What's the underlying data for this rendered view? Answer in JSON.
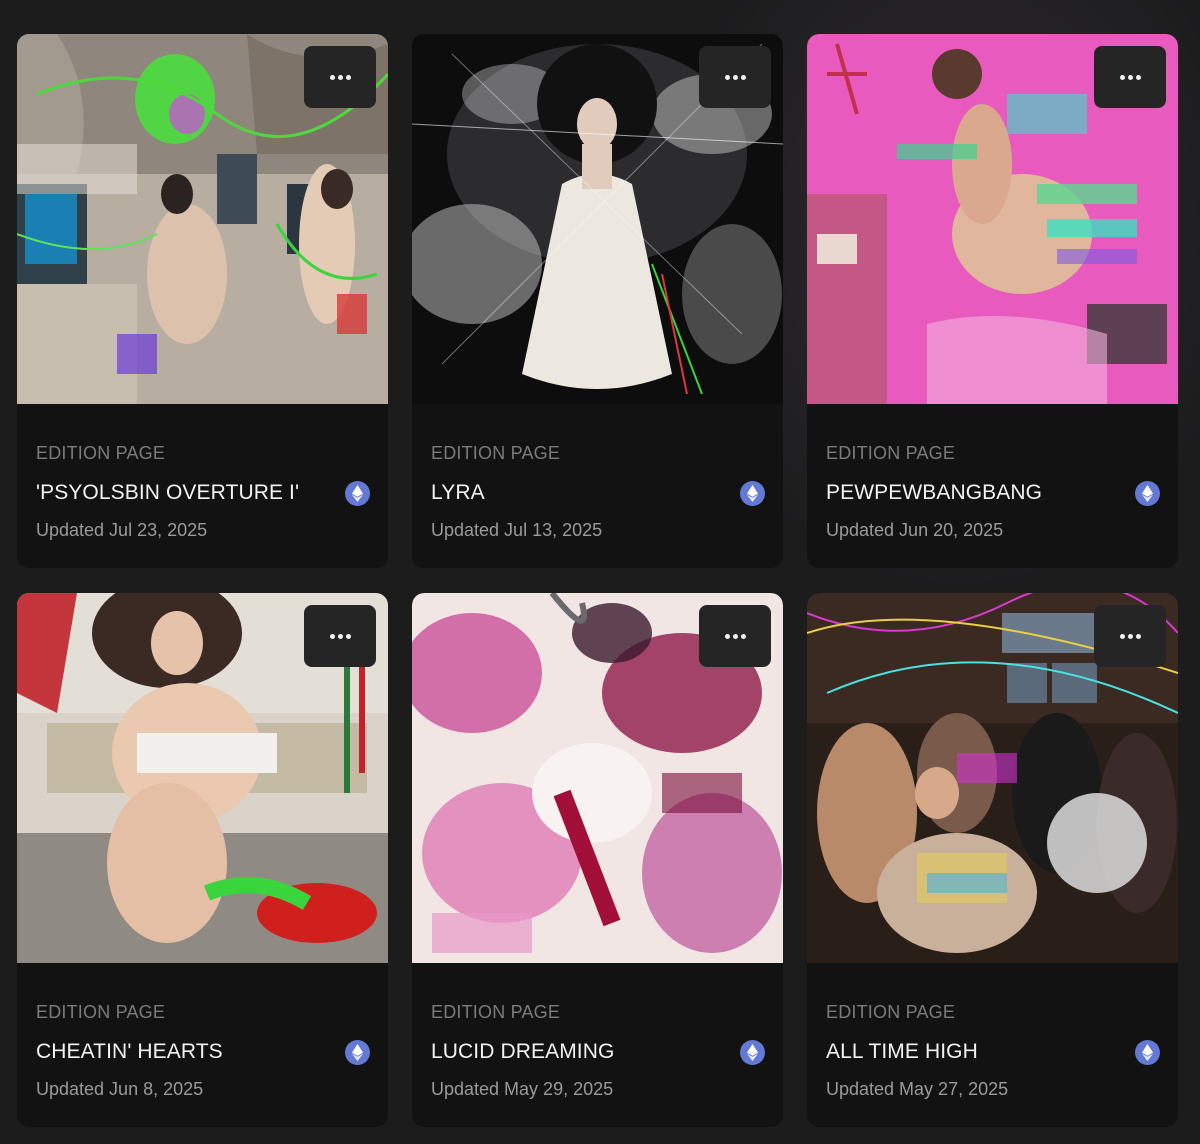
{
  "cards": [
    {
      "kind": "EDITION PAGE",
      "title": "'PSYOLSBIN OVERTURE I'",
      "updated": "Updated Jul 23, 2025",
      "chain_icon": "ethereum-icon",
      "menu_icon": "more-horizontal-icon"
    },
    {
      "kind": "EDITION PAGE",
      "title": "LYRA",
      "updated": "Updated Jul 13, 2025",
      "chain_icon": "ethereum-icon",
      "menu_icon": "more-horizontal-icon"
    },
    {
      "kind": "EDITION PAGE",
      "title": "PEWPEWBANGBANG",
      "updated": "Updated Jun 20, 2025",
      "chain_icon": "ethereum-icon",
      "menu_icon": "more-horizontal-icon"
    },
    {
      "kind": "EDITION PAGE",
      "title": "CHEATIN' HEARTS",
      "updated": "Updated Jun 8, 2025",
      "chain_icon": "ethereum-icon",
      "menu_icon": "more-horizontal-icon"
    },
    {
      "kind": "EDITION PAGE",
      "title": "LUCID DREAMING",
      "updated": "Updated May 29, 2025",
      "chain_icon": "ethereum-icon",
      "menu_icon": "more-horizontal-icon"
    },
    {
      "kind": "EDITION PAGE",
      "title": "ALL TIME HIGH",
      "updated": "Updated May 27, 2025",
      "chain_icon": "ethereum-icon",
      "menu_icon": "more-horizontal-icon"
    }
  ],
  "colors": {
    "background": "#1c1c1d",
    "card": "#121212",
    "button": "#252525",
    "ethereum": "#6479d6"
  }
}
